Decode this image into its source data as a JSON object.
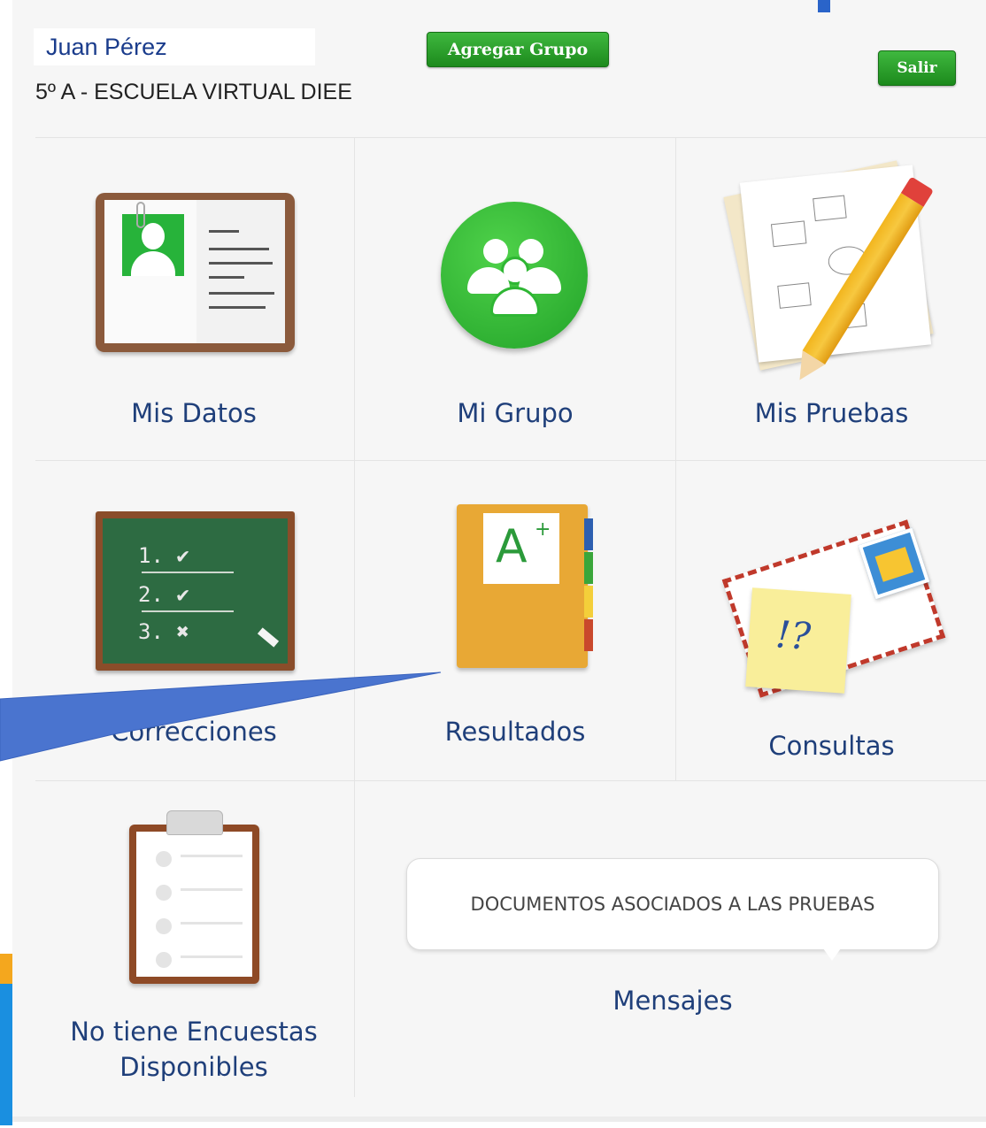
{
  "header": {
    "user_name": "Juan Pérez",
    "school": "5º A - ESCUELA VIRTUAL DIEE",
    "add_group_label": "Agregar Grupo",
    "exit_label": "Salir"
  },
  "tiles": [
    {
      "label": "Mis Datos",
      "icon": "notebook-profile-icon"
    },
    {
      "label": "Mi Grupo",
      "icon": "group-people-icon"
    },
    {
      "label": "Mis Pruebas",
      "icon": "pencil-paper-icon"
    },
    {
      "label": "Correcciones",
      "icon": "chalkboard-checklist-icon"
    },
    {
      "label": "Resultados",
      "icon": "grade-folder-icon"
    },
    {
      "label": "Consultas",
      "icon": "envelope-note-icon"
    },
    {
      "label": "No tiene Encuestas Disponibles",
      "icon": "clipboard-icon"
    },
    {
      "label": "Mensajes",
      "icon": "speech-bubble-icon"
    }
  ],
  "messages": {
    "documents_label": "DOCUMENTOS ASOCIADOS A LAS PRUEBAS"
  },
  "board": {
    "line1": "1. ✔",
    "line2": "2. ✔",
    "line3": "3. ✖"
  },
  "grade": {
    "letter": "A",
    "plus": "+"
  },
  "note": {
    "text": "!?"
  },
  "colors": {
    "button_green": "#22951f",
    "label_blue": "#1f3f7a",
    "annotation_arrow": "#3f6bc8"
  }
}
